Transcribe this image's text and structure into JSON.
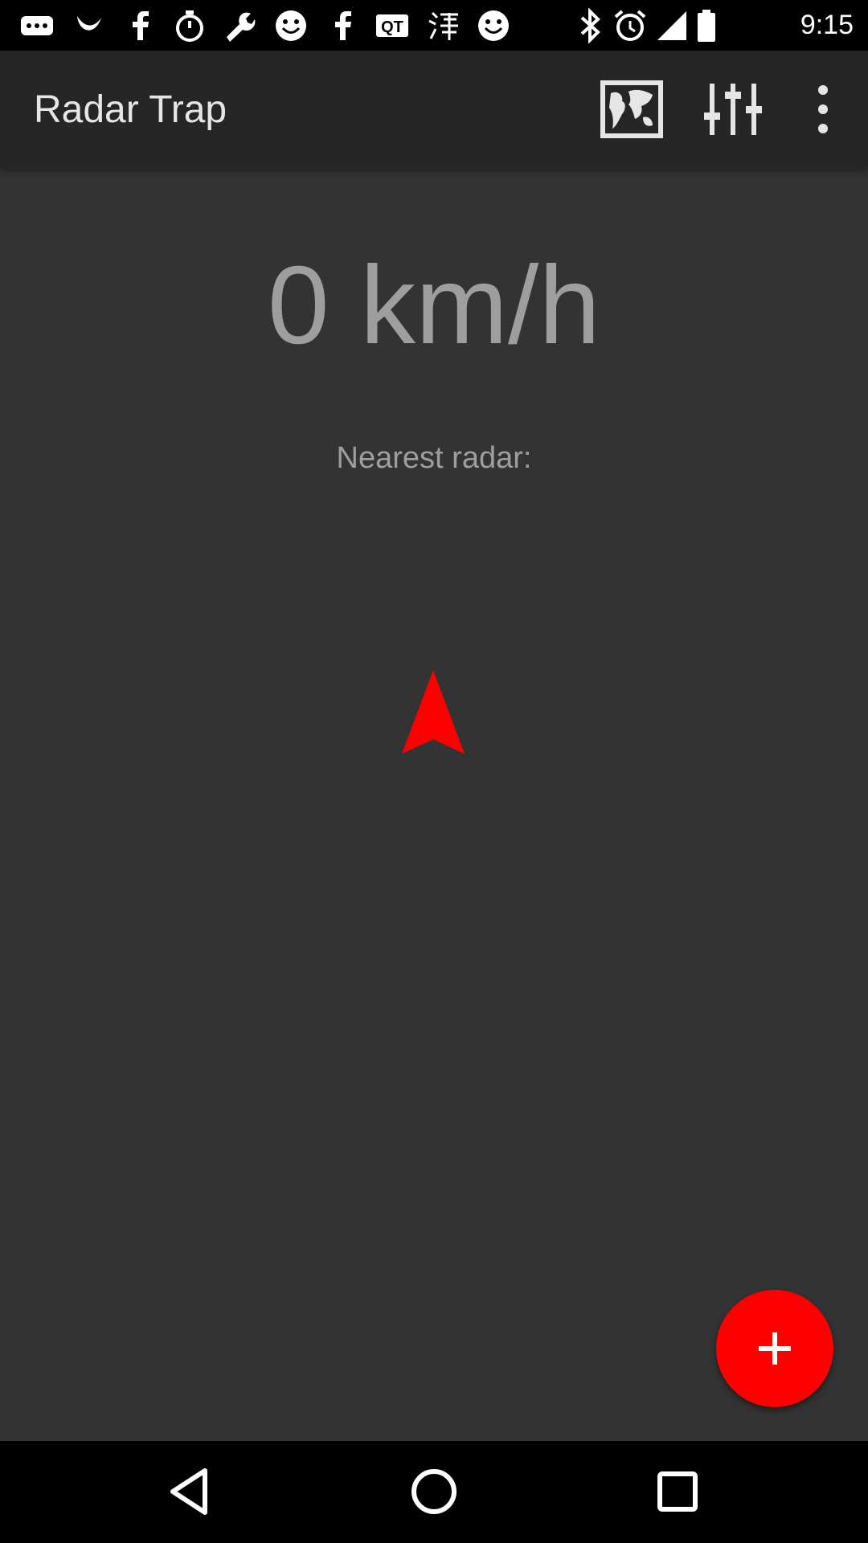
{
  "status_bar": {
    "time": "9:15",
    "notification_icons": [
      "more-notifications-icon",
      "bird-icon",
      "facebook-icon",
      "stopwatch-icon",
      "wrench-icon",
      "smiley-icon",
      "facebook-icon",
      "qt-icon",
      "chinese-app-icon",
      "smiley-icon",
      "bluetooth-icon",
      "alarm-icon",
      "signal-icon",
      "battery-icon"
    ]
  },
  "app_bar": {
    "title": "Radar Trap",
    "actions": [
      "map-icon",
      "sliders-icon",
      "overflow-menu-icon"
    ]
  },
  "main": {
    "speed": "0 km/h",
    "nearest_radar_label": "Nearest radar:",
    "direction_icon": "navigation-arrow-icon",
    "accent_color": "#ff0000"
  },
  "fab": {
    "icon": "plus-icon"
  },
  "nav_bar": {
    "buttons": [
      "back-icon",
      "home-icon",
      "recents-icon"
    ]
  }
}
